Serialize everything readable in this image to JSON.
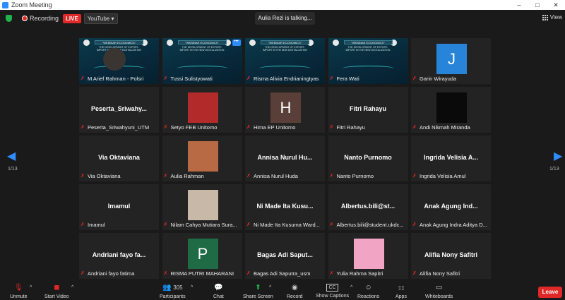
{
  "window": {
    "title": "Zoom Meeting",
    "min": "–",
    "max": "□",
    "close": "✕"
  },
  "topbar": {
    "recording_label": "Recording",
    "live_label": "LIVE",
    "stream_target": "YouTube ▾",
    "talking": "Aulia Rezi is talking...",
    "view_label": "View"
  },
  "pager": {
    "left_arrow": "◀",
    "right_arrow": "▶",
    "left_count": "1/13",
    "right_count": "1/13"
  },
  "tiles": [
    {
      "name": "M Arief Rahman - Polsri",
      "type": "screen",
      "active": true
    },
    {
      "name": "Tussi Sulistyowati",
      "type": "screen"
    },
    {
      "name": "Risma Alivia Endrianingtyas",
      "type": "screen"
    },
    {
      "name": "Fera Wati",
      "type": "screen"
    },
    {
      "name": "Garin Wirayuda",
      "type": "avatar",
      "letter": "J",
      "avatar_color": "#2784d8"
    },
    {
      "name": "Peserta_Sriwahyuni_UTM",
      "display": "Peserta_Sriwahy...",
      "type": "name"
    },
    {
      "name": "Setyo FEB Unitomo",
      "type": "photo",
      "photo_color": "#b22a2a"
    },
    {
      "name": "Hima EP Unitomo",
      "type": "avatar",
      "letter": "H",
      "avatar_color": "#5a3f38"
    },
    {
      "name": "Fitri Rahayu",
      "display": "Fitri Rahayu",
      "type": "name"
    },
    {
      "name": "Andi Nikmah Miranda",
      "type": "avatar",
      "letter": "",
      "avatar_color": "#0a0a0a"
    },
    {
      "name": "Via Oktaviana",
      "display": "Via Oktaviana",
      "type": "name"
    },
    {
      "name": "Aulia Rahman",
      "type": "photo",
      "photo_color": "#b86a44"
    },
    {
      "name": "Annisa Nurul Huda",
      "display": "Annisa Nurul Hu...",
      "type": "name"
    },
    {
      "name": "Nanto Purnomo",
      "display": "Nanto Purnomo",
      "type": "name"
    },
    {
      "name": "Ingrida Velisia Amul",
      "display": "Ingrida Velisia A...",
      "type": "name"
    },
    {
      "name": "Imamul",
      "display": "Imamul",
      "type": "name"
    },
    {
      "name": "Nilam Cahya Mutiara Sura...",
      "type": "photo",
      "photo_color": "#c7b8a8"
    },
    {
      "name": "Ni Made Ita Kusuma Ward...",
      "display": "Ni Made Ita Kusu...",
      "type": "name"
    },
    {
      "name": "Albertus.bili@student.ukdc...",
      "display": "Albertus.bili@st...",
      "type": "name"
    },
    {
      "name": "Anak Agung Indra Aditya D...",
      "display": "Anak Agung Ind...",
      "type": "name"
    },
    {
      "name": "Andriani fayo fatima",
      "display": "Andriani fayo fa...",
      "type": "name"
    },
    {
      "name": "RISMA PUTRI MAHARANI",
      "type": "avatar",
      "letter": "P",
      "avatar_color": "#1e6b45"
    },
    {
      "name": "Bagas Adi Saputra_usm",
      "display": "Bagas Adi Saput...",
      "type": "name"
    },
    {
      "name": "Yulia Rahma Sapitri",
      "type": "photo",
      "photo_color": "#f2a4c4"
    },
    {
      "name": "Alifia Nony Safitri",
      "display": "Alifia Nony Safitri",
      "type": "name"
    }
  ],
  "screen_share": {
    "header": "\"WEBINAR ECONOMICS\"",
    "sub": "THE DEVELOPMENT OF EXPORT-IMPORT IN THE NEW DIGITALIZATION"
  },
  "toolbar": {
    "unmute": "Unmute",
    "start_video": "Start Video",
    "participants": "Participants",
    "participants_count": "305",
    "chat": "Chat",
    "share_screen": "Share Screen",
    "record": "Record",
    "show_captions": "Show Captions",
    "reactions": "Reactions",
    "apps": "Apps",
    "whiteboards": "Whiteboards",
    "leave": "Leave",
    "cc_glyph": "CC"
  },
  "colors": {
    "accent": "#2d8cff",
    "danger": "#e02828",
    "active_border": "#2ec23a",
    "share_green": "#22b14c"
  }
}
